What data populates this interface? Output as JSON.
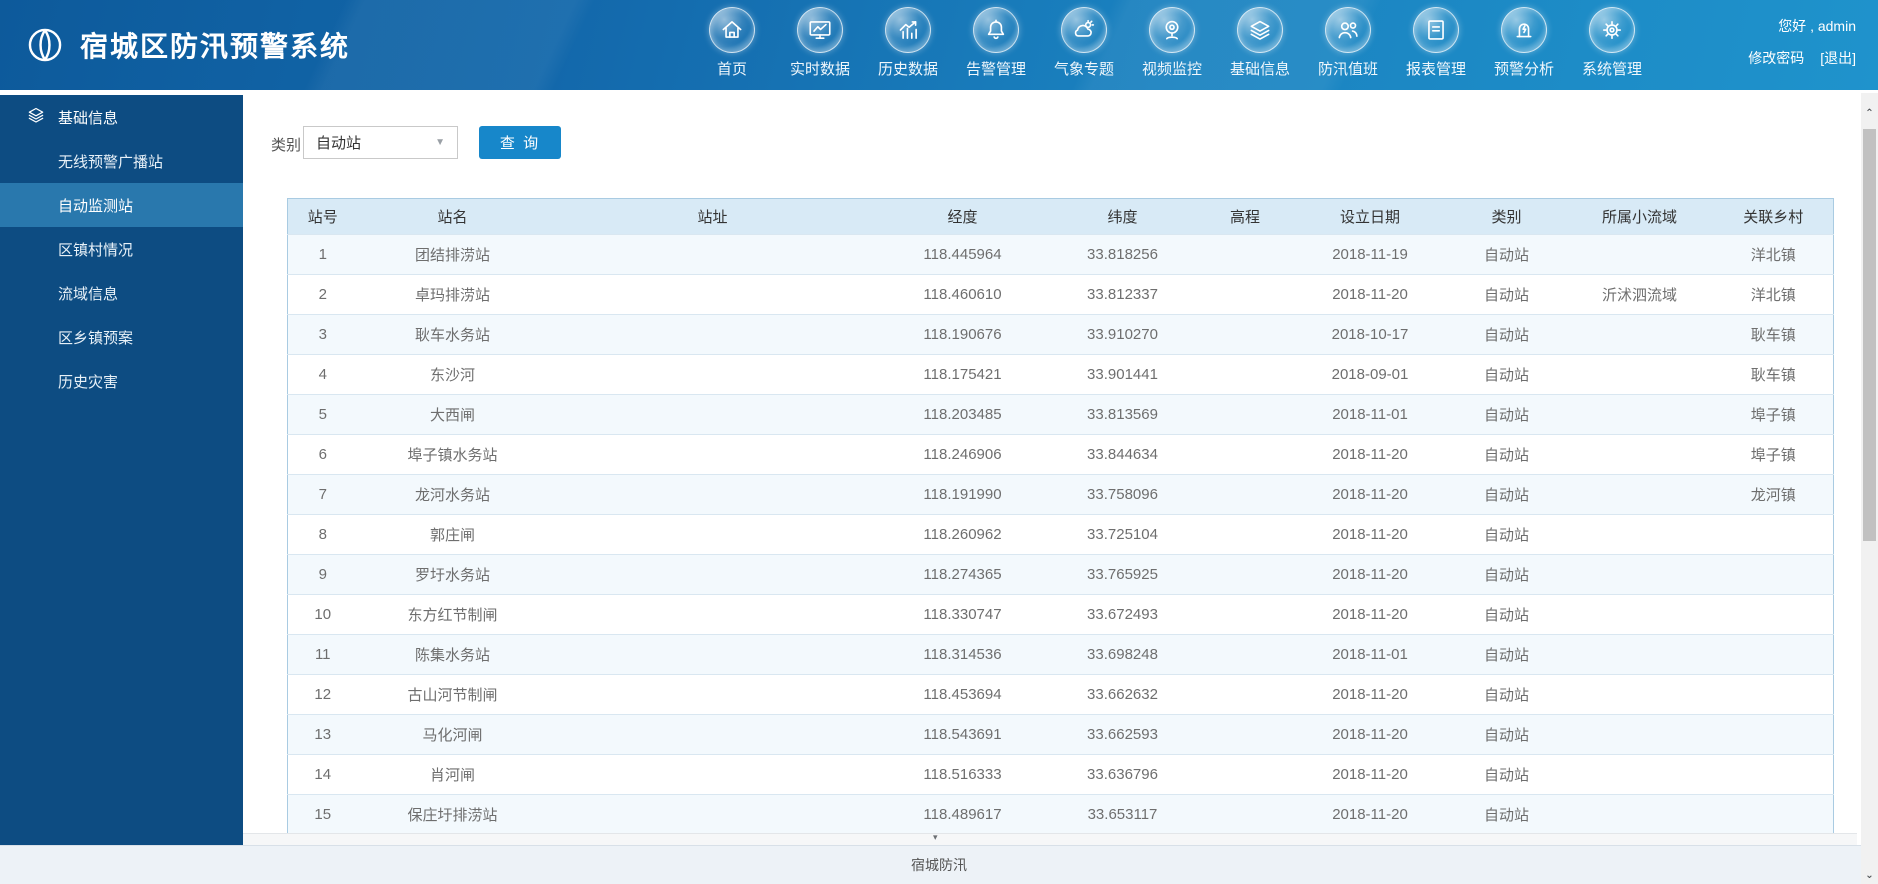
{
  "app": {
    "title": "宿城区防汛预警系统",
    "footer": "宿城防汛"
  },
  "header": {
    "nav": [
      {
        "id": "home",
        "label": "首页"
      },
      {
        "id": "realtime-data",
        "label": "实时数据"
      },
      {
        "id": "history-data",
        "label": "历史数据"
      },
      {
        "id": "alert-management",
        "label": "告警管理"
      },
      {
        "id": "weather-special",
        "label": "气象专题"
      },
      {
        "id": "video-monitor",
        "label": "视频监控"
      },
      {
        "id": "basic-info",
        "label": "基础信息"
      },
      {
        "id": "flood-duty",
        "label": "防汛值班"
      },
      {
        "id": "report-management",
        "label": "报表管理"
      },
      {
        "id": "warning-analysis",
        "label": "预警分析"
      },
      {
        "id": "system-management",
        "label": "系统管理"
      }
    ],
    "user": {
      "greeting": "您好 , admin",
      "change_password": "修改密码",
      "logout": "[退出]"
    }
  },
  "sidebar": {
    "group": {
      "icon": "layers-icon",
      "label": "基础信息"
    },
    "items": [
      {
        "label": "无线预警广播站",
        "active": false
      },
      {
        "label": "自动监测站",
        "active": true
      },
      {
        "label": "区镇村情况",
        "active": false
      },
      {
        "label": "流域信息",
        "active": false
      },
      {
        "label": "区乡镇预案",
        "active": false
      },
      {
        "label": "历史灾害",
        "active": false
      }
    ]
  },
  "filter": {
    "label": "类别",
    "selected": "自动站",
    "button": "查 询"
  },
  "table": {
    "columns": [
      "站号",
      "站名",
      "站址",
      "经度",
      "纬度",
      "高程",
      "设立日期",
      "类别",
      "所属小流域",
      "关联乡村"
    ],
    "rows": [
      {
        "no": "1",
        "name": "团结排涝站",
        "address": "",
        "lng": "118.445964",
        "lat": "33.818256",
        "elevation": "",
        "date": "2018-11-19",
        "category": "自动站",
        "basin": "",
        "village": "洋北镇"
      },
      {
        "no": "2",
        "name": "卓玛排涝站",
        "address": "",
        "lng": "118.460610",
        "lat": "33.812337",
        "elevation": "",
        "date": "2018-11-20",
        "category": "自动站",
        "basin": "沂沭泗流域",
        "village": "洋北镇"
      },
      {
        "no": "3",
        "name": "耿车水务站",
        "address": "",
        "lng": "118.190676",
        "lat": "33.910270",
        "elevation": "",
        "date": "2018-10-17",
        "category": "自动站",
        "basin": "",
        "village": "耿车镇"
      },
      {
        "no": "4",
        "name": "东沙河",
        "address": "",
        "lng": "118.175421",
        "lat": "33.901441",
        "elevation": "",
        "date": "2018-09-01",
        "category": "自动站",
        "basin": "",
        "village": "耿车镇"
      },
      {
        "no": "5",
        "name": "大西闸",
        "address": "",
        "lng": "118.203485",
        "lat": "33.813569",
        "elevation": "",
        "date": "2018-11-01",
        "category": "自动站",
        "basin": "",
        "village": "埠子镇"
      },
      {
        "no": "6",
        "name": "埠子镇水务站",
        "address": "",
        "lng": "118.246906",
        "lat": "33.844634",
        "elevation": "",
        "date": "2018-11-20",
        "category": "自动站",
        "basin": "",
        "village": "埠子镇"
      },
      {
        "no": "7",
        "name": "龙河水务站",
        "address": "",
        "lng": "118.191990",
        "lat": "33.758096",
        "elevation": "",
        "date": "2018-11-20",
        "category": "自动站",
        "basin": "",
        "village": "龙河镇"
      },
      {
        "no": "8",
        "name": "郭庄闸",
        "address": "",
        "lng": "118.260962",
        "lat": "33.725104",
        "elevation": "",
        "date": "2018-11-20",
        "category": "自动站",
        "basin": "",
        "village": ""
      },
      {
        "no": "9",
        "name": "罗圩水务站",
        "address": "",
        "lng": "118.274365",
        "lat": "33.765925",
        "elevation": "",
        "date": "2018-11-20",
        "category": "自动站",
        "basin": "",
        "village": ""
      },
      {
        "no": "10",
        "name": "东方红节制闸",
        "address": "",
        "lng": "118.330747",
        "lat": "33.672493",
        "elevation": "",
        "date": "2018-11-20",
        "category": "自动站",
        "basin": "",
        "village": ""
      },
      {
        "no": "11",
        "name": "陈集水务站",
        "address": "",
        "lng": "118.314536",
        "lat": "33.698248",
        "elevation": "",
        "date": "2018-11-01",
        "category": "自动站",
        "basin": "",
        "village": ""
      },
      {
        "no": "12",
        "name": "古山河节制闸",
        "address": "",
        "lng": "118.453694",
        "lat": "33.662632",
        "elevation": "",
        "date": "2018-11-20",
        "category": "自动站",
        "basin": "",
        "village": ""
      },
      {
        "no": "13",
        "name": "马化河闸",
        "address": "",
        "lng": "118.543691",
        "lat": "33.662593",
        "elevation": "",
        "date": "2018-11-20",
        "category": "自动站",
        "basin": "",
        "village": ""
      },
      {
        "no": "14",
        "name": "肖河闸",
        "address": "",
        "lng": "118.516333",
        "lat": "33.636796",
        "elevation": "",
        "date": "2018-11-20",
        "category": "自动站",
        "basin": "",
        "village": ""
      },
      {
        "no": "15",
        "name": "保庄圩排涝站",
        "address": "",
        "lng": "118.489617",
        "lat": "33.653117",
        "elevation": "",
        "date": "2018-11-20",
        "category": "自动站",
        "basin": "",
        "village": ""
      }
    ]
  },
  "colors": {
    "header_gradient_start": "#0d5a9b",
    "header_gradient_end": "#1f93cc",
    "sidebar_bg": "#0d4c82",
    "sidebar_active": "#2978ad",
    "accent_button": "#1787ca",
    "table_header_bg": "#d8eaf6",
    "row_alt_bg": "#f3f9fd",
    "footer_bg": "#edf2f7"
  }
}
